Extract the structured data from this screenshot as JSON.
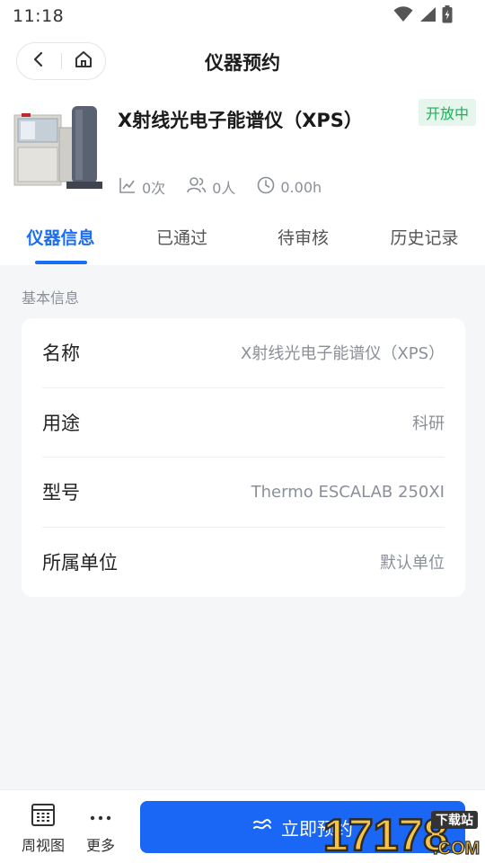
{
  "status_bar": {
    "time": "11:18",
    "icons": [
      "wifi-icon",
      "signal-icon",
      "battery-icon"
    ]
  },
  "header": {
    "title": "仪器预约",
    "back_icon": "chevron-left-icon",
    "home_icon": "home-icon"
  },
  "instrument": {
    "name": "X射线光电子能谱仪（XPS）",
    "status": "开放中",
    "stats": [
      {
        "icon": "chart-icon",
        "value": "0次"
      },
      {
        "icon": "users-icon",
        "value": "0人"
      },
      {
        "icon": "clock-icon",
        "value": "0.00h"
      }
    ]
  },
  "tabs": [
    {
      "label": "仪器信息",
      "active": true
    },
    {
      "label": "已通过",
      "active": false
    },
    {
      "label": "待审核",
      "active": false
    },
    {
      "label": "历史记录",
      "active": false
    }
  ],
  "section": {
    "title": "基本信息"
  },
  "info_rows": [
    {
      "key": "名称",
      "value": "X射线光电子能谱仪（XPS）"
    },
    {
      "key": "用途",
      "value": "科研"
    },
    {
      "key": "型号",
      "value": "Thermo ESCALAB 250XI"
    },
    {
      "key": "所属单位",
      "value": "默认单位"
    }
  ],
  "bottom": {
    "week_view": "周视图",
    "more": "更多",
    "reserve": "立即预约"
  },
  "watermark": {
    "text": "17178",
    "sub": ".COM",
    "tag": "下载站"
  },
  "colors": {
    "accent": "#1a6df5",
    "open_badge_bg": "#e6f6ec",
    "open_badge_text": "#1bb157"
  }
}
